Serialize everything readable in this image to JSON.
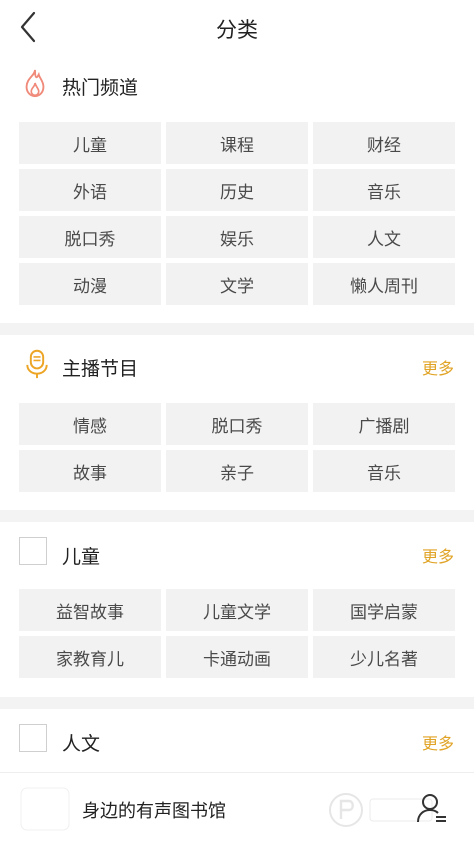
{
  "header": {
    "title": "分类",
    "back_icon": "chevron-left-icon"
  },
  "accent_color": "#e0a325",
  "hot": {
    "title": "热门频道",
    "icon": "flame-icon",
    "items": [
      "儿童",
      "课程",
      "财经",
      "外语",
      "历史",
      "音乐",
      "脱口秀",
      "娱乐",
      "人文",
      "动漫",
      "文学",
      "懒人周刊"
    ]
  },
  "anchor": {
    "title": "主播节目",
    "icon": "microphone-icon",
    "more": "更多",
    "items": [
      "情感",
      "脱口秀",
      "广播剧",
      "故事",
      "亲子",
      "音乐"
    ]
  },
  "children": {
    "title": "儿童",
    "more": "更多",
    "items": [
      "益智故事",
      "儿童文学",
      "国学启蒙",
      "家教育儿",
      "卡通动画",
      "少儿名著"
    ]
  },
  "humanities": {
    "title": "人文",
    "more": "更多"
  },
  "bottom_bar": {
    "text": "身边的有声图书馆",
    "user_icon": "user-icon"
  }
}
